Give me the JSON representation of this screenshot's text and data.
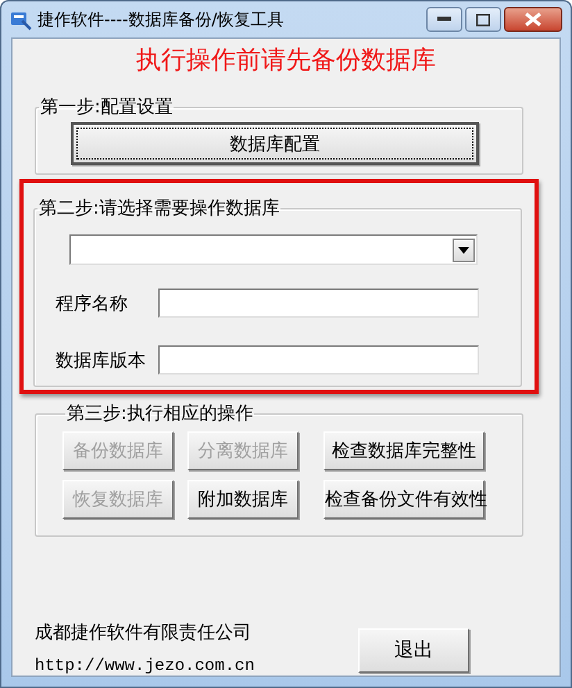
{
  "window": {
    "title": "捷作软件----数据库备份/恢复工具"
  },
  "warning": "执行操作前请先备份数据库",
  "step1": {
    "title": "第一步:配置设置",
    "button": "数据库配置"
  },
  "step2": {
    "title": "第二步:请选择需要操作数据库",
    "fields": [
      {
        "label": "程序名称"
      },
      {
        "label": "数据库版本"
      }
    ]
  },
  "step3": {
    "title": "第三步:执行相应的操作",
    "buttons": [
      {
        "label": "备份数据库",
        "disabled": true
      },
      {
        "label": "分离数据库",
        "disabled": true
      },
      {
        "label": "检查数据库完整性",
        "disabled": false
      },
      {
        "label": "恢复数据库",
        "disabled": true
      },
      {
        "label": "附加数据库",
        "disabled": false
      },
      {
        "label": "检查备份文件有效性",
        "disabled": false
      }
    ]
  },
  "footer": {
    "company": "成都捷作软件有限责任公司",
    "url": "http://www.jezo.com.cn",
    "exit_button": "退出"
  }
}
